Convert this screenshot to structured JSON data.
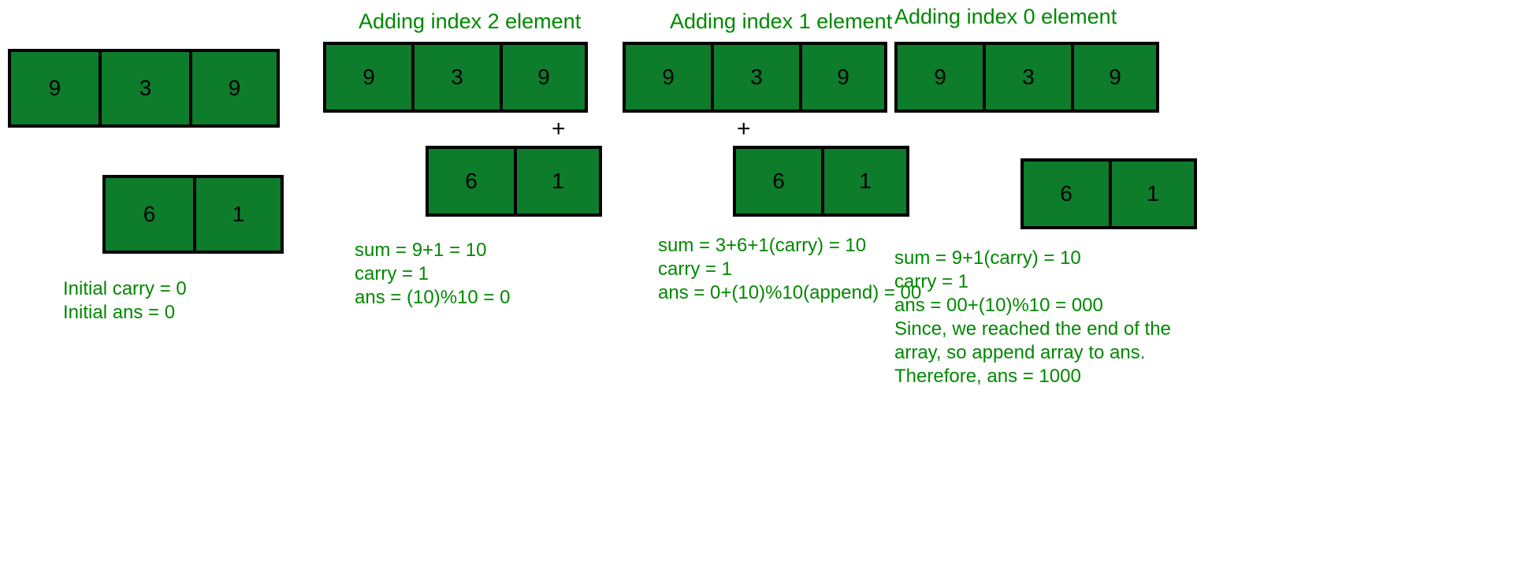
{
  "steps": [
    {
      "heading": "",
      "arr1": [
        "9",
        "3",
        "9"
      ],
      "arr2": [
        "6",
        "1"
      ],
      "plus": "",
      "explain": "Initial carry = 0\nInitial ans = 0"
    },
    {
      "heading": "Adding index 2 element",
      "arr1": [
        "9",
        "3",
        "9"
      ],
      "arr2": [
        "6",
        "1"
      ],
      "plus": "+",
      "explain": "sum = 9+1 = 10\ncarry = 1\nans = (10)%10 = 0"
    },
    {
      "heading": "Adding index 1 element",
      "arr1": [
        "9",
        "3",
        "9"
      ],
      "arr2": [
        "6",
        "1"
      ],
      "plus": "+",
      "explain": "sum = 3+6+1(carry) = 10\ncarry = 1\nans = 0+(10)%10(append) = 00"
    },
    {
      "heading": "Adding index 0 element",
      "arr1": [
        "9",
        "3",
        "9"
      ],
      "arr2": [
        "6",
        "1"
      ],
      "plus": "",
      "explain": "sum = 9+1(carry) = 10\ncarry = 1\nans = 00+(10)%10 = 000\nSince, we reached the end of the array, so append array to ans.  Therefore, ans = 1000"
    }
  ]
}
